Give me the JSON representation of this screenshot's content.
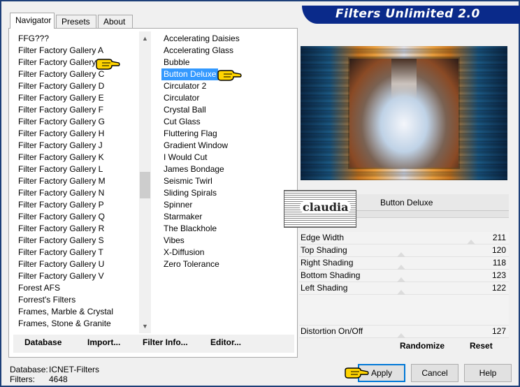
{
  "app": {
    "title": "Filters Unlimited 2.0"
  },
  "tabs": [
    {
      "label": "Navigator",
      "active": true
    },
    {
      "label": "Presets",
      "active": false
    },
    {
      "label": "About",
      "active": false
    }
  ],
  "categories": [
    "FFG???",
    "Filter Factory Gallery A",
    "Filter Factory Gallery B",
    "Filter Factory Gallery C",
    "Filter Factory Gallery D",
    "Filter Factory Gallery E",
    "Filter Factory Gallery F",
    "Filter Factory Gallery G",
    "Filter Factory Gallery H",
    "Filter Factory Gallery J",
    "Filter Factory Gallery K",
    "Filter Factory Gallery L",
    "Filter Factory Gallery M",
    "Filter Factory Gallery N",
    "Filter Factory Gallery P",
    "Filter Factory Gallery Q",
    "Filter Factory Gallery R",
    "Filter Factory Gallery S",
    "Filter Factory Gallery T",
    "Filter Factory Gallery U",
    "Filter Factory Gallery V",
    "Forest AFS",
    "Forrest's Filters",
    "Frames, Marble & Crystal",
    "Frames, Stone & Granite"
  ],
  "filters": [
    "Accelerating Daisies",
    "Accelerating Glass",
    "Bubble",
    "Button Deluxe",
    "Circulator 2",
    "Circulator",
    "Crystal Ball",
    "Cut Glass",
    "Fluttering Flag",
    "Gradient Window",
    "I Would Cut",
    "James Bondage",
    "Seismic Twirl",
    "Sliding Spirals",
    "Spinner",
    "Starmaker",
    "The Blackhole",
    "Vibes",
    "X-Diffusion",
    "Zero Tolerance"
  ],
  "selected_filter_index": 3,
  "left_buttons": {
    "database": "Database",
    "import": "Import...",
    "filter_info": "Filter Info...",
    "editor": "Editor..."
  },
  "selected_filter_name": "Button Deluxe",
  "params": [
    {
      "label": "Edge Width",
      "value": "211"
    },
    {
      "label": "Top Shading",
      "value": "120"
    },
    {
      "label": "Right Shading",
      "value": "118"
    },
    {
      "label": "Bottom Shading",
      "value": "123"
    },
    {
      "label": "Left Shading",
      "value": "122"
    }
  ],
  "param_extra": {
    "label": "Distortion On/Off",
    "value": "127"
  },
  "right_buttons": {
    "randomize": "Randomize",
    "reset": "Reset"
  },
  "status": {
    "database_label": "Database:",
    "database_value": "ICNET-Filters",
    "filters_label": "Filters:",
    "filters_value": "4648"
  },
  "footer_buttons": {
    "apply": "Apply",
    "cancel": "Cancel",
    "help": "Help"
  },
  "watermark": "claudia",
  "colors": {
    "banner": "#0a2a8a",
    "selection": "#3399ff",
    "default_button_border": "#0078d7"
  }
}
